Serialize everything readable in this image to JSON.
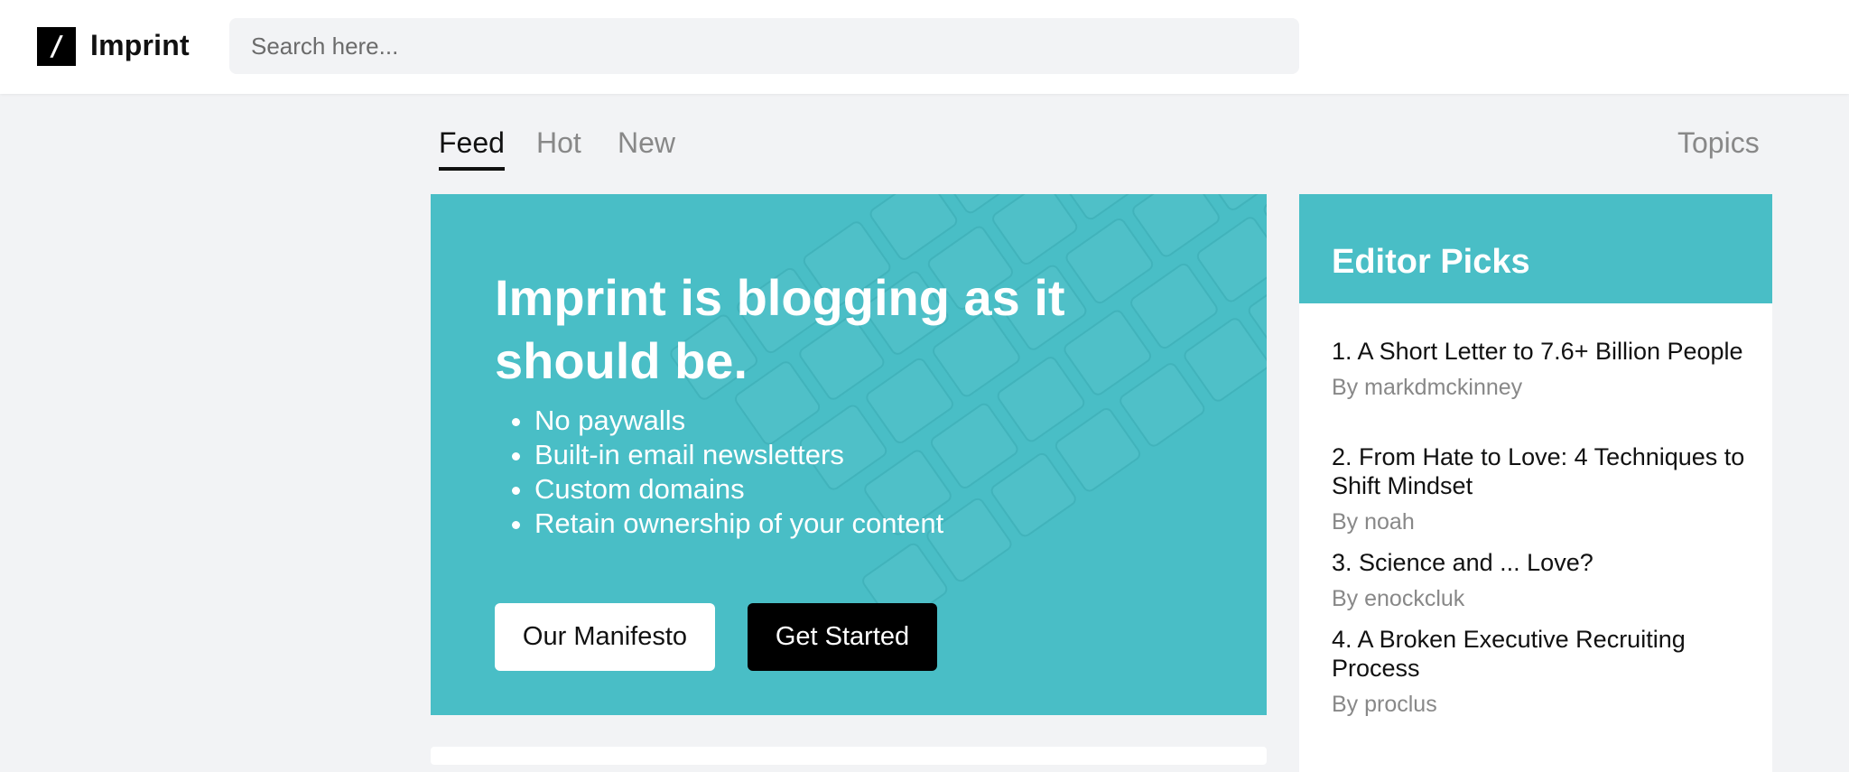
{
  "header": {
    "logo_glyph": "/",
    "app_name": "Imprint",
    "search_placeholder": "Search here..."
  },
  "tabs": {
    "items": [
      "Feed",
      "Hot",
      "New"
    ],
    "active": "Feed",
    "topics_label": "Topics"
  },
  "hero": {
    "title": "Imprint is blogging as it should be.",
    "features": [
      "No paywalls",
      "Built-in email newsletters",
      "Custom domains",
      "Retain ownership of your content"
    ],
    "primary_button": "Our Manifesto",
    "secondary_button": "Get Started",
    "background_color": "#49bec6"
  },
  "editor_picks": {
    "heading": "Editor Picks",
    "items": [
      {
        "number": "1.",
        "title": "A Short Letter to 7.6+ Billion People",
        "author": "By markdmckinney"
      },
      {
        "number": "2.",
        "title": "From Hate to Love: 4 Techniques to Shift Mindset",
        "author": "By noah"
      },
      {
        "number": "3.",
        "title": "Science and ... Love?",
        "author": "By enockcluk"
      },
      {
        "number": "4.",
        "title": "A Broken Executive Recruiting Process",
        "author": "By proclus"
      }
    ]
  },
  "colors": {
    "accent": "#49bec6",
    "page_background": "#f2f3f5",
    "dark_button": "#000000"
  }
}
